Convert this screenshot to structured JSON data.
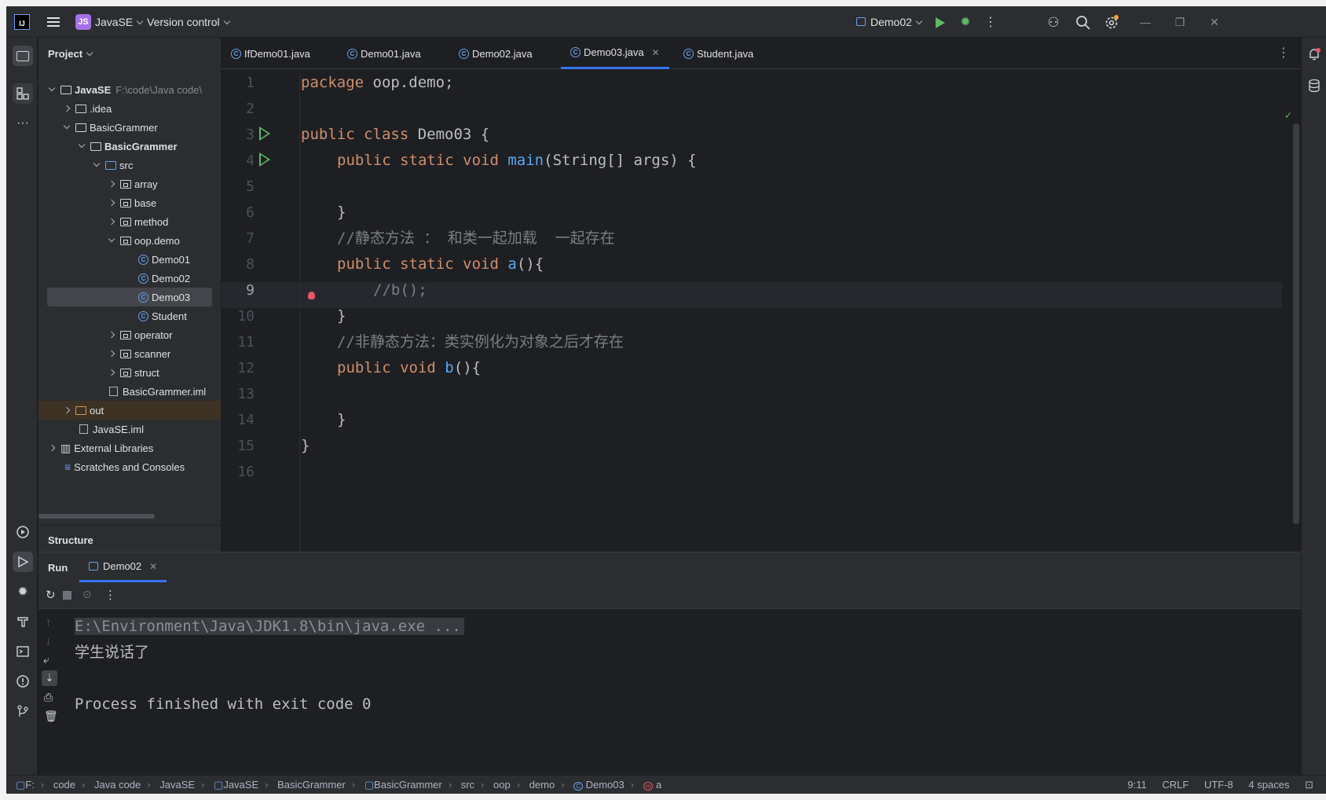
{
  "titlebar": {
    "project_badge": "JS",
    "project_name": "JavaSE",
    "version_control": "Version control",
    "run_config": "Demo02"
  },
  "project_panel": {
    "header": "Project",
    "structure_label": "Structure",
    "tree": [
      {
        "label": "JavaSE",
        "path": "F:\\code\\Java code\\"
      },
      {
        "label": ".idea"
      },
      {
        "label": "BasicGrammer"
      },
      {
        "label": "BasicGrammer"
      },
      {
        "label": "src"
      },
      {
        "label": "array"
      },
      {
        "label": "base"
      },
      {
        "label": "method"
      },
      {
        "label": "oop.demo"
      },
      {
        "label": "Demo01"
      },
      {
        "label": "Demo02"
      },
      {
        "label": "Demo03"
      },
      {
        "label": "Student"
      },
      {
        "label": "operator"
      },
      {
        "label": "scanner"
      },
      {
        "label": "struct"
      },
      {
        "label": "BasicGrammer.iml"
      },
      {
        "label": "out"
      },
      {
        "label": "JavaSE.iml"
      },
      {
        "label": "External Libraries"
      },
      {
        "label": "Scratches and Consoles"
      }
    ]
  },
  "editor": {
    "tabs": [
      {
        "label": "IfDemo01.java"
      },
      {
        "label": "Demo01.java"
      },
      {
        "label": "Demo02.java"
      },
      {
        "label": "Demo03.java",
        "active": true
      },
      {
        "label": "Student.java"
      }
    ],
    "line_numbers": [
      "1",
      "2",
      "3",
      "4",
      "5",
      "6",
      "7",
      "8",
      "9",
      "10",
      "11",
      "12",
      "13",
      "14",
      "15",
      "16"
    ],
    "code": {
      "l1_kw": "package",
      "l1_rest": " oop.demo;",
      "l3_kw": "public class",
      "l3_rest": " Demo03 {",
      "l4_kw": "public static void",
      "l4_fn": "main",
      "l4_rest": "(String[] args) {",
      "l6": "}",
      "l7": "//静态方法 ： 和类一起加载  一起存在",
      "l8_kw": "public static void",
      "l8_fn": "a",
      "l8_rest": "(){",
      "l9": "//b();",
      "l10": "}",
      "l11": "//非静态方法：类实例化为对象之后才存在",
      "l12_kw": "public void",
      "l12_fn": "b",
      "l12_rest": "(){",
      "l14": "}",
      "l15": "}"
    }
  },
  "run_panel": {
    "title": "Run",
    "tab_label": "Demo02",
    "console": [
      "E:\\Environment\\Java\\JDK1.8\\bin\\java.exe ...",
      "学生说话了",
      "",
      "Process finished with exit code 0"
    ]
  },
  "statusbar": {
    "breadcrumbs": [
      "F:",
      "code",
      "Java code",
      "JavaSE",
      "JavaSE",
      "BasicGrammer",
      "BasicGrammer",
      "src",
      "oop",
      "demo",
      "Demo03",
      "a"
    ],
    "position": "9:11",
    "line_sep": "CRLF",
    "encoding": "UTF-8",
    "indent": "4 spaces"
  },
  "colors": {
    "accent": "#3574f0",
    "run_green": "#5fb865",
    "keyword": "#cf8e6d",
    "function": "#56a8f5",
    "comment": "#7a7e85"
  }
}
